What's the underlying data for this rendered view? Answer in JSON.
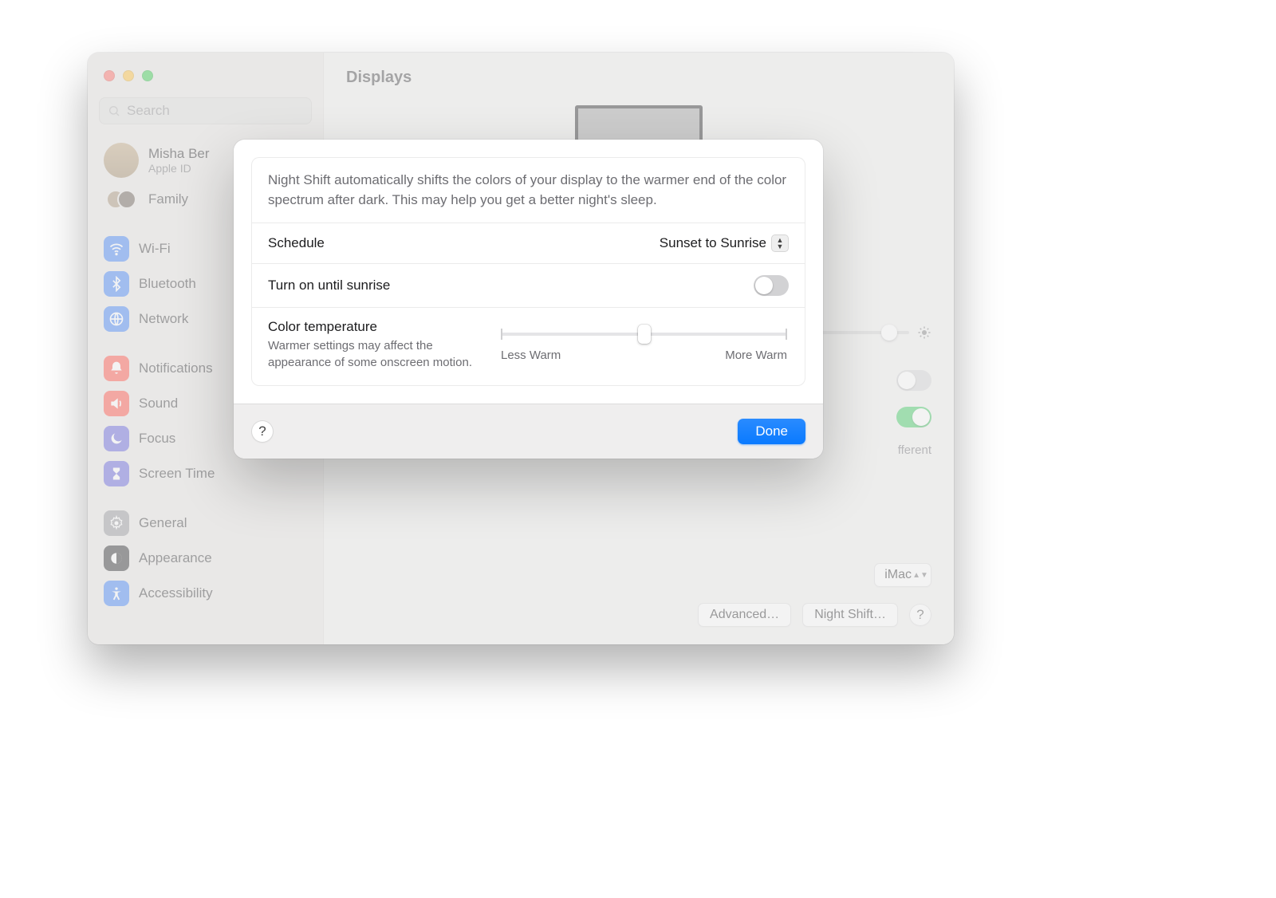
{
  "window": {
    "title": "Displays"
  },
  "search": {
    "placeholder": "Search"
  },
  "account": {
    "name": "Misha Ber",
    "sub": "Apple ID"
  },
  "family": {
    "label": "Family"
  },
  "sidebar": {
    "items": [
      {
        "id": "wifi",
        "label": "Wi-Fi"
      },
      {
        "id": "bluetooth",
        "label": "Bluetooth"
      },
      {
        "id": "network",
        "label": "Network"
      },
      {
        "id": "notifications",
        "label": "Notifications"
      },
      {
        "id": "sound",
        "label": "Sound"
      },
      {
        "id": "focus",
        "label": "Focus"
      },
      {
        "id": "screen-time",
        "label": "Screen Time"
      },
      {
        "id": "general",
        "label": "General"
      },
      {
        "id": "appearance",
        "label": "Appearance"
      },
      {
        "id": "accessibility",
        "label": "Accessibility"
      }
    ]
  },
  "bg": {
    "popup": "iMac",
    "advanced": "Advanced…",
    "night_shift_btn": "Night Shift…",
    "text_fragment": "fferent"
  },
  "modal": {
    "description": "Night Shift automatically shifts the colors of your display to the warmer end of the color spectrum after dark. This may help you get a better night's sleep.",
    "schedule_label": "Schedule",
    "schedule_value": "Sunset to Sunrise",
    "turn_on_label": "Turn on until sunrise",
    "turn_on": false,
    "temp_title": "Color temperature",
    "temp_sub": "Warmer settings may affect the appearance of some onscreen motion.",
    "less_warm": "Less Warm",
    "more_warm": "More Warm",
    "done": "Done",
    "slider_percent": 50
  }
}
